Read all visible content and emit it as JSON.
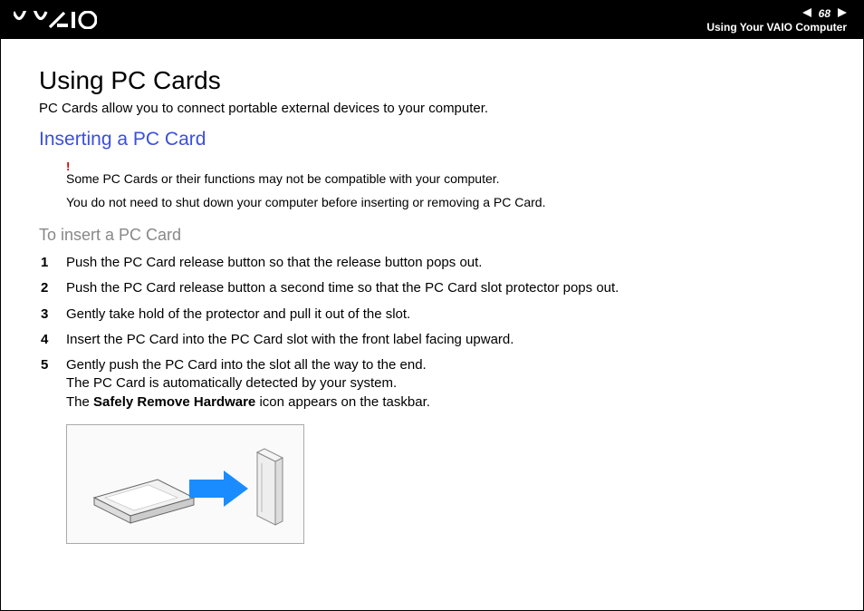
{
  "header": {
    "page_number": "68",
    "section": "Using Your VAIO Computer"
  },
  "title": "Using PC Cards",
  "intro": "PC Cards allow you to connect portable external devices to your computer.",
  "subheading": "Inserting a PC Card",
  "warning_mark": "!",
  "note1": "Some PC Cards or their functions may not be compatible with your computer.",
  "note2": "You do not need to shut down your computer before inserting or removing a PC Card.",
  "procedure_heading": "To insert a PC Card",
  "steps": {
    "s1": "Push the PC Card release button so that the release button pops out.",
    "s2": "Push the PC Card release button a second time so that the PC Card slot protector pops out.",
    "s3": "Gently take hold of the protector and pull it out of the slot.",
    "s4": "Insert the PC Card into the PC Card slot with the front label facing upward.",
    "s5a": "Gently push the PC Card into the slot all the way to the end.",
    "s5b": "The PC Card is automatically detected by your system.",
    "s5c_prefix": "The ",
    "s5c_bold": "Safely Remove Hardware",
    "s5c_suffix": " icon appears on the taskbar."
  }
}
